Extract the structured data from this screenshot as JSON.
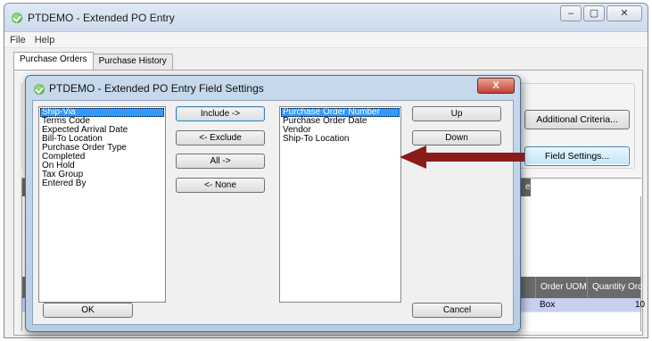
{
  "main_window": {
    "title": "PTDEMO - Extended PO Entry",
    "controls": {
      "minimize": "–",
      "maximize": "▢",
      "close": "✕"
    }
  },
  "menu": {
    "items": [
      "File",
      "Help"
    ]
  },
  "tabs": [
    {
      "label": "Purchase Orders"
    },
    {
      "label": "Purchase History"
    }
  ],
  "background_buttons": {
    "additional_criteria": "Additional Criteria...",
    "field_settings": "Field Settings..."
  },
  "grid_top": {
    "reference_header": "eference"
  },
  "grid_bottom": {
    "headers": [
      "Order UOM",
      "Quantity Ordered"
    ],
    "row": {
      "order_uom": "Box",
      "quantity_ordered": "10"
    }
  },
  "dialog": {
    "title": "PTDEMO - Extended PO Entry Field Settings",
    "close_label": "X",
    "available_fields": [
      "Ship-Via",
      "Terms Code",
      "Expected Arrival Date",
      "Bill-To Location",
      "Purchase Order Type",
      "Completed",
      "On Hold",
      "Tax Group",
      "Entered By"
    ],
    "selected_fields": [
      "Purchase Order Number",
      "Purchase Order Date",
      "Vendor",
      "Ship-To Location"
    ],
    "buttons": {
      "include": "Include ->",
      "exclude": "<- Exclude",
      "all": "All ->",
      "none": "<- None",
      "up": "Up",
      "down": "Down",
      "ok": "OK",
      "cancel": "Cancel"
    }
  },
  "annotation": {
    "arrow_color": "#8b1a1a"
  },
  "colors": {
    "selection": "#3399ff",
    "grid_header": "#666666",
    "row_highlight": "#c8d0f0"
  }
}
